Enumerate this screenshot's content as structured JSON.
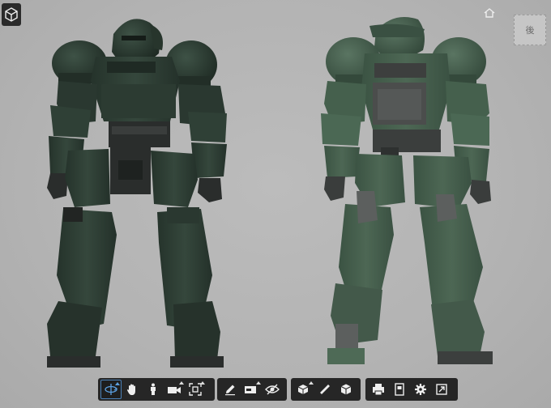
{
  "viewer": {
    "viewcube_label": "後",
    "toolbar_groups": [
      {
        "id": "navigation",
        "tools": [
          "orbit-icon",
          "pan-icon",
          "walk-person-icon",
          "camera-icon",
          "fit-view-icon"
        ]
      },
      {
        "id": "markup",
        "tools": [
          "pencil-icon",
          "measure-section-icon",
          "visibility-eye-icon"
        ]
      },
      {
        "id": "model",
        "tools": [
          "explode-cube-icon",
          "ruler-icon",
          "cube-parts-icon"
        ]
      },
      {
        "id": "settings",
        "tools": [
          "print-icon",
          "document-icon",
          "gear-icon",
          "fullscreen-icon"
        ]
      }
    ]
  },
  "colors": {
    "background": "#b4b4b4",
    "armor": "#2f3f36",
    "armor_back": "#455d4c",
    "joints": "#3a3d3c",
    "toolbar": "#262626",
    "active_tool_border": "#4a7fb5"
  }
}
